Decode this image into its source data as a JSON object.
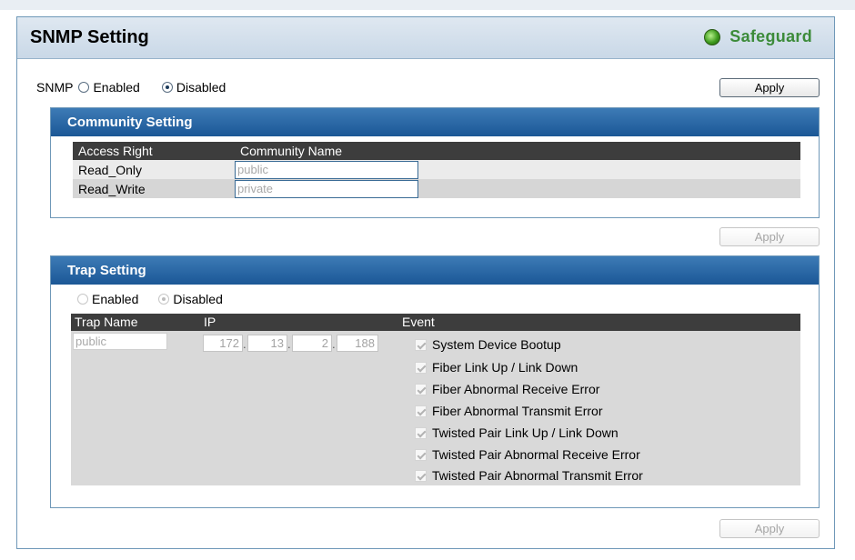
{
  "page": {
    "title": "SNMP Setting",
    "safeguard_label": "Safeguard",
    "snmp_label": "SNMP",
    "snmp_options": [
      "Enabled",
      "Disabled"
    ],
    "snmp_selected": "Disabled",
    "apply_label": "Apply"
  },
  "community": {
    "header": "Community Setting",
    "columns": [
      "Access Right",
      "Community Name"
    ],
    "rows": [
      {
        "access": "Read_Only",
        "name": "public"
      },
      {
        "access": "Read_Write",
        "name": "private"
      }
    ],
    "apply_label": "Apply"
  },
  "trap": {
    "header": "Trap Setting",
    "options": [
      "Enabled",
      "Disabled"
    ],
    "selected": "Disabled",
    "columns": [
      "Trap Name",
      "IP",
      "Event"
    ],
    "trap_name": "public",
    "ip": [
      "172",
      "13",
      "2",
      "188"
    ],
    "ip_separator": ".",
    "events": [
      "System Device Bootup",
      "Fiber Link Up / Link Down",
      "Fiber Abnormal Receive Error",
      "Fiber Abnormal Transmit Error",
      "Twisted Pair Link Up / Link Down",
      "Twisted Pair Abnormal Receive Error",
      "Twisted Pair Abnormal Transmit Error"
    ],
    "apply_label": "Apply"
  },
  "colors": {
    "panel_header": "#1b5796",
    "frame_border": "#6f98b8",
    "grid_header": "#3d3d3d",
    "row_shade": "#d9d9d9",
    "safeguard_green": "#3c8b3a"
  }
}
